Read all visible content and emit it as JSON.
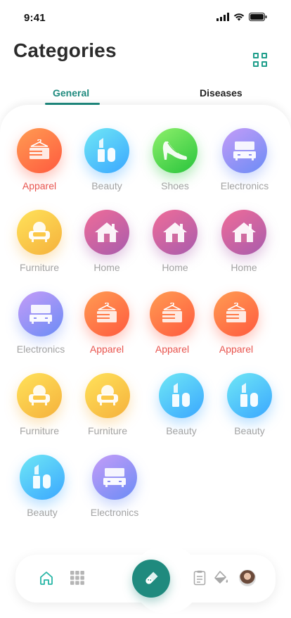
{
  "status_bar": {
    "time": "9:41"
  },
  "header": {
    "title": "Categories"
  },
  "tabs": [
    {
      "label": "General",
      "active": true
    },
    {
      "label": "Diseases",
      "active": false
    }
  ],
  "categories": [
    {
      "label": "Apparel",
      "icon": "apparel-icon",
      "highlight": true
    },
    {
      "label": "Beauty",
      "icon": "beauty-icon",
      "highlight": false
    },
    {
      "label": "Shoes",
      "icon": "shoe-icon",
      "highlight": false
    },
    {
      "label": "Electronics",
      "icon": "electronics-icon",
      "highlight": false
    },
    {
      "label": "Furniture",
      "icon": "furniture-icon",
      "highlight": false
    },
    {
      "label": "Home",
      "icon": "home-icon",
      "highlight": false
    },
    {
      "label": "Home",
      "icon": "home-icon",
      "highlight": false
    },
    {
      "label": "Home",
      "icon": "home-icon",
      "highlight": false
    },
    {
      "label": "Electronics",
      "icon": "electronics-icon",
      "highlight": false
    },
    {
      "label": "Apparel",
      "icon": "apparel-icon",
      "highlight": true
    },
    {
      "label": "Apparel",
      "icon": "apparel-icon",
      "highlight": true
    },
    {
      "label": "Apparel",
      "icon": "apparel-icon",
      "highlight": true
    },
    {
      "label": "Furniture",
      "icon": "furniture-icon",
      "highlight": false
    },
    {
      "label": "Furniture",
      "icon": "furniture-icon",
      "highlight": false
    },
    {
      "label": "Beauty",
      "icon": "beauty-icon",
      "highlight": false
    },
    {
      "label": "Beauty",
      "icon": "beauty-icon",
      "highlight": false
    },
    {
      "label": "Beauty",
      "icon": "beauty-icon",
      "highlight": false
    },
    {
      "label": "Electronics",
      "icon": "electronics-icon",
      "highlight": false
    }
  ],
  "bottom_nav": {
    "items": [
      "home-icon",
      "grid-icon",
      "pill-icon",
      "clipboard-icon",
      "paint-bucket-icon",
      "avatar"
    ]
  },
  "colors": {
    "accent": "#1f8a7e",
    "highlight_text": "#e8544e",
    "muted_text": "#a3a3a3"
  }
}
